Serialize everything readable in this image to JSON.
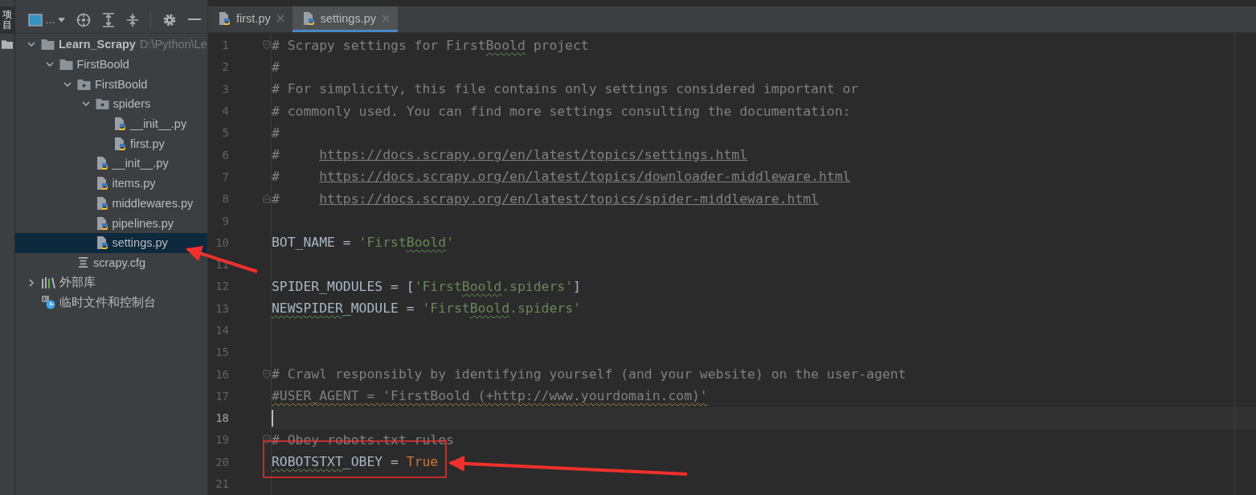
{
  "side_strip": {
    "label": "项目",
    "selected": true
  },
  "project_toolbar": {
    "view_label": "…"
  },
  "tree": [
    {
      "label": "Learn_Scrapy",
      "hint": "D:\\Python\\Le",
      "kind": "folder",
      "expanded": true,
      "selected": false,
      "bold": true,
      "children": [
        {
          "label": "FirstBoold",
          "kind": "folder",
          "expanded": true,
          "selected": false,
          "bold": false,
          "children": [
            {
              "label": "FirstBoold",
              "kind": "package",
              "expanded": true,
              "selected": false,
              "bold": false,
              "children": [
                {
                  "label": "spiders",
                  "kind": "package",
                  "expanded": true,
                  "selected": false,
                  "bold": false,
                  "children": [
                    {
                      "label": "__init__.py",
                      "kind": "python",
                      "selected": false,
                      "bold": false
                    },
                    {
                      "label": "first.py",
                      "kind": "python",
                      "selected": false,
                      "bold": false
                    }
                  ]
                },
                {
                  "label": "__init__.py",
                  "kind": "python",
                  "selected": false,
                  "bold": false
                },
                {
                  "label": "items.py",
                  "kind": "python",
                  "selected": false,
                  "bold": false
                },
                {
                  "label": "middlewares.py",
                  "kind": "python",
                  "selected": false,
                  "bold": false
                },
                {
                  "label": "pipelines.py",
                  "kind": "python",
                  "selected": false,
                  "bold": false
                },
                {
                  "label": "settings.py",
                  "kind": "python",
                  "selected": true,
                  "bold": false
                }
              ]
            },
            {
              "label": "scrapy.cfg",
              "kind": "config",
              "selected": false,
              "bold": false
            }
          ]
        }
      ]
    },
    {
      "label": "外部库",
      "kind": "library",
      "expanded": false,
      "selected": false,
      "bold": false
    },
    {
      "label": "临时文件和控制台",
      "kind": "scratch",
      "selected": false,
      "bold": false
    }
  ],
  "tabs": [
    {
      "label": "first.py",
      "selected": false
    },
    {
      "label": "settings.py",
      "selected": true
    }
  ],
  "code_lines": [
    {
      "number": "1",
      "current": false,
      "kind": "foldstart",
      "segments": [
        {
          "kind": "comment",
          "text": "# Scrapy settings for First"
        },
        {
          "kind": "comment-typo",
          "text": "Boold"
        },
        {
          "kind": "comment",
          "text": " project"
        }
      ]
    },
    {
      "number": "2",
      "current": false,
      "kind": "code",
      "segments": [
        {
          "kind": "comment",
          "text": "#"
        }
      ]
    },
    {
      "number": "3",
      "current": false,
      "kind": "code",
      "segments": [
        {
          "kind": "comment",
          "text": "# For simplicity, this file contains only settings considered important or"
        }
      ]
    },
    {
      "number": "4",
      "current": false,
      "kind": "code",
      "segments": [
        {
          "kind": "comment",
          "text": "# commonly used. You can find more settings consulting the documentation:"
        }
      ]
    },
    {
      "number": "5",
      "current": false,
      "kind": "code",
      "segments": [
        {
          "kind": "comment",
          "text": "#"
        }
      ]
    },
    {
      "number": "6",
      "current": false,
      "kind": "code",
      "segments": [
        {
          "kind": "comment",
          "text": "#     "
        },
        {
          "kind": "link",
          "text": "https://docs.scrapy.org/en/latest/topics/settings.html"
        }
      ]
    },
    {
      "number": "7",
      "current": false,
      "kind": "code",
      "segments": [
        {
          "kind": "comment",
          "text": "#     "
        },
        {
          "kind": "link",
          "text": "https://docs.scrapy.org/en/latest/topics/downloader-middleware.html"
        }
      ]
    },
    {
      "number": "8",
      "current": false,
      "kind": "foldend",
      "segments": [
        {
          "kind": "comment",
          "text": "#     "
        },
        {
          "kind": "link",
          "text": "https://docs.scrapy.org/en/latest/topics/spider-middleware.html"
        }
      ]
    },
    {
      "number": "9",
      "current": false,
      "kind": "code"
    },
    {
      "number": "10",
      "current": false,
      "kind": "code",
      "segments": [
        {
          "kind": "plain",
          "text": "BOT_NAME = "
        },
        {
          "kind": "string",
          "text": "'First"
        },
        {
          "kind": "string-typo",
          "text": "Boold"
        },
        {
          "kind": "string",
          "text": "'"
        }
      ]
    },
    {
      "number": "11",
      "current": false,
      "kind": "code"
    },
    {
      "number": "12",
      "current": false,
      "kind": "code",
      "segments": [
        {
          "kind": "plain",
          "text": "SPIDER_MODULES = ["
        },
        {
          "kind": "string",
          "text": "'First"
        },
        {
          "kind": "string-typo",
          "text": "Boold"
        },
        {
          "kind": "string",
          "text": ".spiders'"
        },
        {
          "kind": "plain",
          "text": "]"
        }
      ]
    },
    {
      "number": "13",
      "current": false,
      "kind": "code",
      "segments": [
        {
          "kind": "plain-typo",
          "text": "NEWSPIDER"
        },
        {
          "kind": "plain",
          "text": "_MODULE = "
        },
        {
          "kind": "string",
          "text": "'First"
        },
        {
          "kind": "string-typo",
          "text": "Boold"
        },
        {
          "kind": "string",
          "text": ".spiders'"
        }
      ]
    },
    {
      "number": "14",
      "current": false,
      "kind": "code"
    },
    {
      "number": "15",
      "current": false,
      "kind": "code"
    },
    {
      "number": "16",
      "current": false,
      "kind": "foldstart",
      "segments": [
        {
          "kind": "comment",
          "text": "# Crawl responsibly by identifying yourself (and your website) on the user-agent"
        }
      ]
    },
    {
      "number": "17",
      "current": false,
      "kind": "code",
      "segments": [
        {
          "kind": "comment-warning",
          "text": "#USER_AGENT = 'FirstBoold (+http://www.yourdomain.com)'"
        }
      ]
    },
    {
      "number": "18",
      "current": true,
      "kind": "code"
    },
    {
      "number": "19",
      "current": false,
      "kind": "foldstart",
      "segments": [
        {
          "kind": "comment",
          "text": "# Obey robots.txt rules"
        }
      ]
    },
    {
      "number": "20",
      "current": false,
      "kind": "code",
      "segments": [
        {
          "kind": "plain-typo",
          "text": "ROBOTSTXT"
        },
        {
          "kind": "plain",
          "text": "_OBEY = "
        },
        {
          "kind": "keyword",
          "text": "True"
        }
      ]
    },
    {
      "number": "21",
      "current": false,
      "kind": "code"
    }
  ]
}
